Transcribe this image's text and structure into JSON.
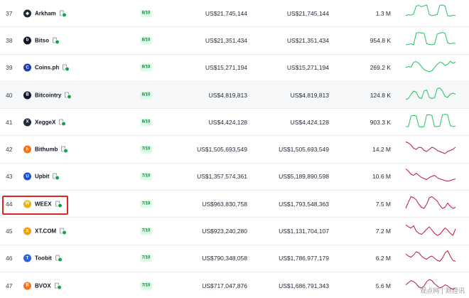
{
  "colors": {
    "up": "#22c55e",
    "down": "#b91c3c",
    "highlight": "#dc2626",
    "score_bg": "#dcfce7",
    "score_fg": "#15803d"
  },
  "rows": [
    {
      "rank": "37",
      "name": "Arkham",
      "logo_icon": "arkham-logo-icon",
      "logo_bg": "#1f2937",
      "logo_glyph": "◆",
      "score": "8/10",
      "vol1": "US$21,745,144",
      "vol2": "US$21,745,144",
      "visits": "1.3 M",
      "trend": "up",
      "spark": [
        0.4,
        0.45,
        0.42,
        0.48,
        0.85,
        0.88,
        0.82,
        0.86,
        0.9,
        0.45,
        0.4,
        0.42,
        0.45,
        0.88,
        0.9,
        0.85,
        0.4,
        0.38,
        0.42,
        0.4
      ]
    },
    {
      "rank": "38",
      "name": "Bitso",
      "logo_icon": "bitso-logo-icon",
      "logo_bg": "#111827",
      "logo_glyph": "b",
      "score": "8/10",
      "vol1": "US$21,351,434",
      "vol2": "US$21,351,434",
      "visits": "954.8 K",
      "trend": "up",
      "spark": [
        0.3,
        0.32,
        0.35,
        0.3,
        0.85,
        0.88,
        0.86,
        0.84,
        0.35,
        0.32,
        0.3,
        0.33,
        0.8,
        0.85,
        0.88,
        0.84,
        0.4,
        0.35,
        0.38,
        0.36
      ]
    },
    {
      "rank": "39",
      "name": "Coins.ph",
      "logo_icon": "coinsph-logo-icon",
      "logo_bg": "#1e40af",
      "logo_glyph": "C",
      "score": "8/10",
      "vol1": "US$15,271,194",
      "vol2": "US$15,271,194",
      "visits": "269.2 K",
      "trend": "up",
      "spark": [
        0.5,
        0.55,
        0.52,
        0.75,
        0.78,
        0.7,
        0.55,
        0.4,
        0.35,
        0.3,
        0.35,
        0.5,
        0.65,
        0.75,
        0.72,
        0.6,
        0.65,
        0.8,
        0.7,
        0.75
      ]
    },
    {
      "rank": "40",
      "name": "Bitcointry",
      "logo_icon": "bitcointry-logo-icon",
      "logo_bg": "#111827",
      "logo_glyph": "B",
      "score": "8/10",
      "vol1": "US$4,819,813",
      "vol2": "US$4,819,813",
      "visits": "124.8 K",
      "trend": "up",
      "spark": [
        0.3,
        0.35,
        0.55,
        0.7,
        0.65,
        0.4,
        0.35,
        0.7,
        0.75,
        0.4,
        0.35,
        0.38,
        0.8,
        0.85,
        0.7,
        0.45,
        0.4,
        0.55,
        0.6,
        0.55
      ]
    },
    {
      "rank": "41",
      "name": "XeggeX",
      "logo_icon": "xeggex-logo-icon",
      "logo_bg": "#1f2937",
      "logo_glyph": "X",
      "score": "8/10",
      "vol1": "US$4,424,128",
      "vol2": "US$4,424,128",
      "visits": "903.3 K",
      "trend": "up",
      "spark": [
        0.3,
        0.3,
        0.8,
        0.82,
        0.8,
        0.3,
        0.28,
        0.3,
        0.85,
        0.85,
        0.82,
        0.3,
        0.3,
        0.32,
        0.85,
        0.88,
        0.86,
        0.35,
        0.3,
        0.32
      ]
    },
    {
      "rank": "42",
      "name": "Bithumb",
      "logo_icon": "bithumb-logo-icon",
      "logo_bg": "#f97316",
      "logo_glyph": "b",
      "score": "7/10",
      "vol1": "US$1,505,693,549",
      "vol2": "US$1,505,693,549",
      "visits": "14.2 M",
      "trend": "down",
      "spark": [
        0.85,
        0.8,
        0.7,
        0.55,
        0.5,
        0.6,
        0.58,
        0.45,
        0.4,
        0.5,
        0.6,
        0.55,
        0.45,
        0.4,
        0.35,
        0.3,
        0.4,
        0.45,
        0.5,
        0.6
      ]
    },
    {
      "rank": "43",
      "name": "Upbit",
      "logo_icon": "upbit-logo-icon",
      "logo_bg": "#1d4ed8",
      "logo_glyph": "U",
      "score": "7/10",
      "vol1": "US$1,357,574,361",
      "vol2": "US$5,189,890,598",
      "visits": "10.6 M",
      "trend": "down",
      "spark": [
        0.85,
        0.75,
        0.6,
        0.55,
        0.65,
        0.55,
        0.45,
        0.4,
        0.35,
        0.45,
        0.5,
        0.55,
        0.45,
        0.38,
        0.35,
        0.3,
        0.28,
        0.3,
        0.35,
        0.38
      ]
    },
    {
      "rank": "44",
      "name": "WEEX",
      "logo_icon": "weex-logo-icon",
      "logo_bg": "#eab308",
      "logo_glyph": "W",
      "score": "7/10",
      "vol1": "US$963,830,758",
      "vol2": "US$1,793,548,363",
      "visits": "7.5 M",
      "trend": "down",
      "spark": [
        0.3,
        0.6,
        0.85,
        0.8,
        0.7,
        0.5,
        0.35,
        0.3,
        0.5,
        0.8,
        0.85,
        0.75,
        0.65,
        0.45,
        0.3,
        0.35,
        0.55,
        0.4,
        0.3,
        0.35
      ]
    },
    {
      "rank": "45",
      "name": "XT.COM",
      "logo_icon": "xtcom-logo-icon",
      "logo_bg": "#f59e0b",
      "logo_glyph": "X",
      "score": "7/10",
      "vol1": "US$923,240,280",
      "vol2": "US$1,131,704,107",
      "visits": "7.2 M",
      "trend": "down",
      "spark": [
        0.8,
        0.7,
        0.65,
        0.75,
        0.5,
        0.4,
        0.35,
        0.45,
        0.6,
        0.7,
        0.55,
        0.4,
        0.3,
        0.35,
        0.5,
        0.65,
        0.55,
        0.4,
        0.3,
        0.6
      ]
    },
    {
      "rank": "46",
      "name": "Toobit",
      "logo_icon": "toobit-logo-icon",
      "logo_bg": "#2563eb",
      "logo_glyph": "T",
      "score": "7/10",
      "vol1": "US$790,348,058",
      "vol2": "US$1,786,977,179",
      "visits": "6.2 M",
      "trend": "down",
      "spark": [
        0.7,
        0.6,
        0.55,
        0.65,
        0.8,
        0.75,
        0.6,
        0.5,
        0.45,
        0.55,
        0.6,
        0.5,
        0.4,
        0.35,
        0.5,
        0.75,
        0.85,
        0.6,
        0.4,
        0.35
      ]
    },
    {
      "rank": "47",
      "name": "BVOX",
      "logo_icon": "bvox-logo-icon",
      "logo_bg": "#f97316",
      "logo_glyph": "B",
      "score": "7/10",
      "vol1": "US$717,047,876",
      "vol2": "US$1,686,791,343",
      "visits": "5.6 M",
      "trend": "down",
      "spark": [
        0.55,
        0.65,
        0.75,
        0.7,
        0.6,
        0.45,
        0.4,
        0.5,
        0.7,
        0.8,
        0.75,
        0.6,
        0.5,
        0.4,
        0.45,
        0.55,
        0.5,
        0.4,
        0.35,
        0.4
      ]
    }
  ],
  "watermark": "观点网 | 财经讯"
}
